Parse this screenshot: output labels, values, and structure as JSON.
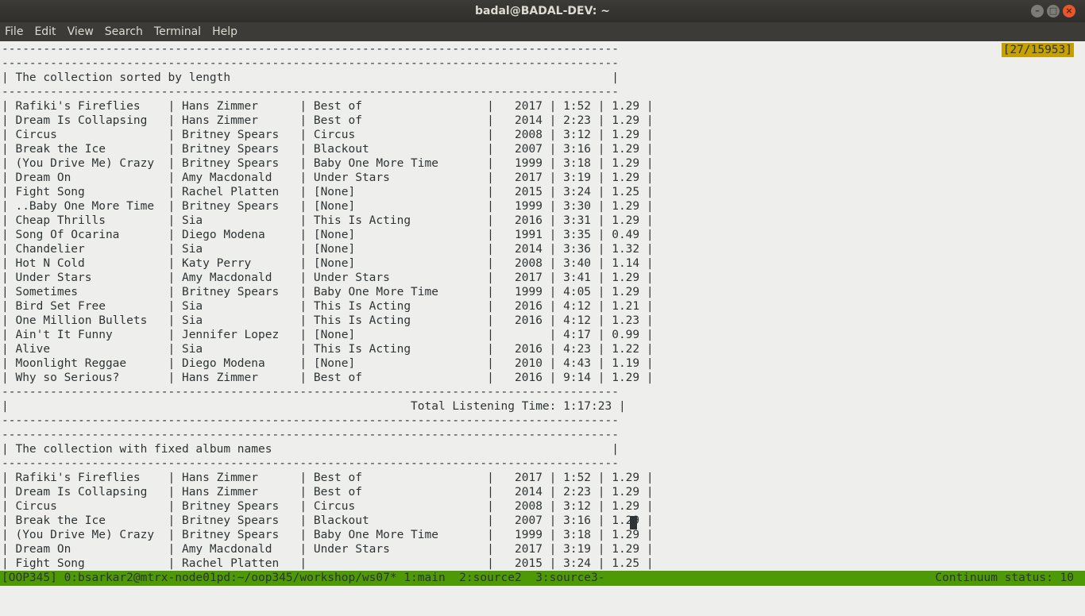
{
  "window": {
    "title": "badal@BADAL-DEV: ~",
    "buttons": {
      "minimize": "–",
      "maximize": "□",
      "close": "×"
    }
  },
  "menu": [
    "File",
    "Edit",
    "View",
    "Search",
    "Terminal",
    "Help"
  ],
  "terminal": {
    "scroll_position": "[27/15953]",
    "lines": [
      "-----------------------------------------------------------------------------------------",
      "-----------------------------------------------------------------------------------------",
      "| The collection sorted by length                                                       |",
      "-----------------------------------------------------------------------------------------",
      "| Rafiki's Fireflies    | Hans Zimmer      | Best of                  |   2017 | 1:52 | 1.29 |",
      "| Dream Is Collapsing   | Hans Zimmer      | Best of                  |   2014 | 2:23 | 1.29 |",
      "| Circus                | Britney Spears   | Circus                   |   2008 | 3:12 | 1.29 |",
      "| Break the Ice         | Britney Spears   | Blackout                 |   2007 | 3:16 | 1.29 |",
      "| (You Drive Me) Crazy  | Britney Spears   | Baby One More Time       |   1999 | 3:18 | 1.29 |",
      "| Dream On              | Amy Macdonald    | Under Stars              |   2017 | 3:19 | 1.29 |",
      "| Fight Song            | Rachel Platten   | [None]                   |   2015 | 3:24 | 1.25 |",
      "| ..Baby One More Time  | Britney Spears   | [None]                   |   1999 | 3:30 | 1.29 |",
      "| Cheap Thrills         | Sia              | This Is Acting           |   2016 | 3:31 | 1.29 |",
      "| Song Of Ocarina       | Diego Modena     | [None]                   |   1991 | 3:35 | 0.49 |",
      "| Chandelier            | Sia              | [None]                   |   2014 | 3:36 | 1.32 |",
      "| Hot N Cold            | Katy Perry       | [None]                   |   2008 | 3:40 | 1.14 |",
      "| Under Stars           | Amy Macdonald    | Under Stars              |   2017 | 3:41 | 1.29 |",
      "| Sometimes             | Britney Spears   | Baby One More Time       |   1999 | 4:05 | 1.29 |",
      "| Bird Set Free         | Sia              | This Is Acting           |   2016 | 4:12 | 1.21 |",
      "| One Million Bullets   | Sia              | This Is Acting           |   2016 | 4:12 | 1.23 |",
      "| Ain't It Funny        | Jennifer Lopez   | [None]                   |        | 4:17 | 0.99 |",
      "| Alive                 | Sia              | This Is Acting           |   2016 | 4:23 | 1.22 |",
      "| Moonlight Reggae      | Diego Modena     | [None]                   |   2010 | 4:43 | 1.19 |",
      "| Why so Serious?       | Hans Zimmer      | Best of                  |   2016 | 9:14 | 1.29 |",
      "-----------------------------------------------------------------------------------------",
      "|                                                          Total Listening Time: 1:17:23 |",
      "-----------------------------------------------------------------------------------------",
      "-----------------------------------------------------------------------------------------",
      "| The collection with fixed album names                                                 |",
      "-----------------------------------------------------------------------------------------",
      "| Rafiki's Fireflies    | Hans Zimmer      | Best of                  |   2017 | 1:52 | 1.29 |",
      "| Dream Is Collapsing   | Hans Zimmer      | Best of                  |   2014 | 2:23 | 1.29 |",
      "| Circus                | Britney Spears   | Circus                   |   2008 | 3:12 | 1.29 |",
      "| Break the Ice         | Britney Spears   | Blackout                 |   2007 | 3:16 | 1.29 |",
      "| (You Drive Me) Crazy  | Britney Spears   | Baby One More Time       |   1999 | 3:18 | 1.29 |",
      "| Dream On              | Amy Macdonald    | Under Stars              |   2017 | 3:19 | 1.29 |",
      "| Fight Song            | Rachel Platten   |                          |   2015 | 3:24 | 1.25 |"
    ]
  },
  "tmux": {
    "left": "[OOP345] 0:bsarkar2@mtrx-node01pd:~/oop345/workshop/ws07* 1:main  2:source2  3:source3-",
    "right": "Continuum status: 10"
  }
}
